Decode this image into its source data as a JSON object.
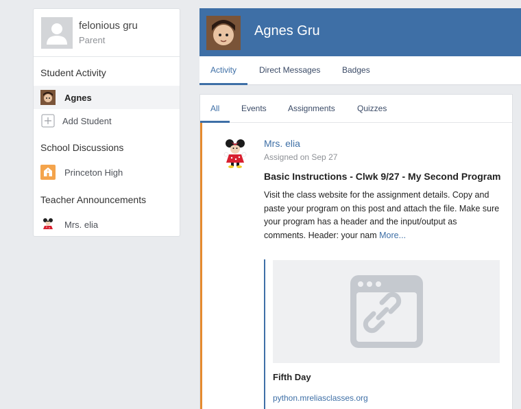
{
  "profile": {
    "name": "felonious gru",
    "role": "Parent",
    "icon": "user-silhouette-icon"
  },
  "sidebar": {
    "student_activity_title": "Student Activity",
    "students": [
      {
        "label": "Agnes",
        "icon": "student-avatar-icon"
      }
    ],
    "add_student_label": "Add Student",
    "school_discussions_title": "School Discussions",
    "schools": [
      {
        "label": "Princeton High",
        "icon": "school-building-icon"
      }
    ],
    "teacher_announcements_title": "Teacher Announcements",
    "teachers": [
      {
        "label": "Mrs. elia",
        "icon": "teacher-avatar-icon"
      }
    ]
  },
  "header": {
    "title": "Agnes Gru"
  },
  "tabs": [
    {
      "label": "Activity",
      "active": true
    },
    {
      "label": "Direct Messages",
      "active": false
    },
    {
      "label": "Badges",
      "active": false
    }
  ],
  "filters": [
    {
      "label": "All",
      "active": true
    },
    {
      "label": "Events",
      "active": false
    },
    {
      "label": "Assignments",
      "active": false
    },
    {
      "label": "Quizzes",
      "active": false
    }
  ],
  "post": {
    "author": "Mrs. elia",
    "meta": "Assigned on Sep 27",
    "title": "Basic Instructions - Clwk 9/27 - My Second Program",
    "body": "Visit the class website for the assignment details. Copy and paste your program on this post and attach the file. Make sure your program has a header and the input/output as comments. Header: your nam",
    "more_label": "More...",
    "attachment": {
      "title": "Fifth Day",
      "url": "python.mreliasclasses.org",
      "icon": "web-link-icon"
    }
  },
  "colors": {
    "accent": "#3e6fa6",
    "post_marker": "#e58a2e",
    "background": "#e9ebee"
  }
}
